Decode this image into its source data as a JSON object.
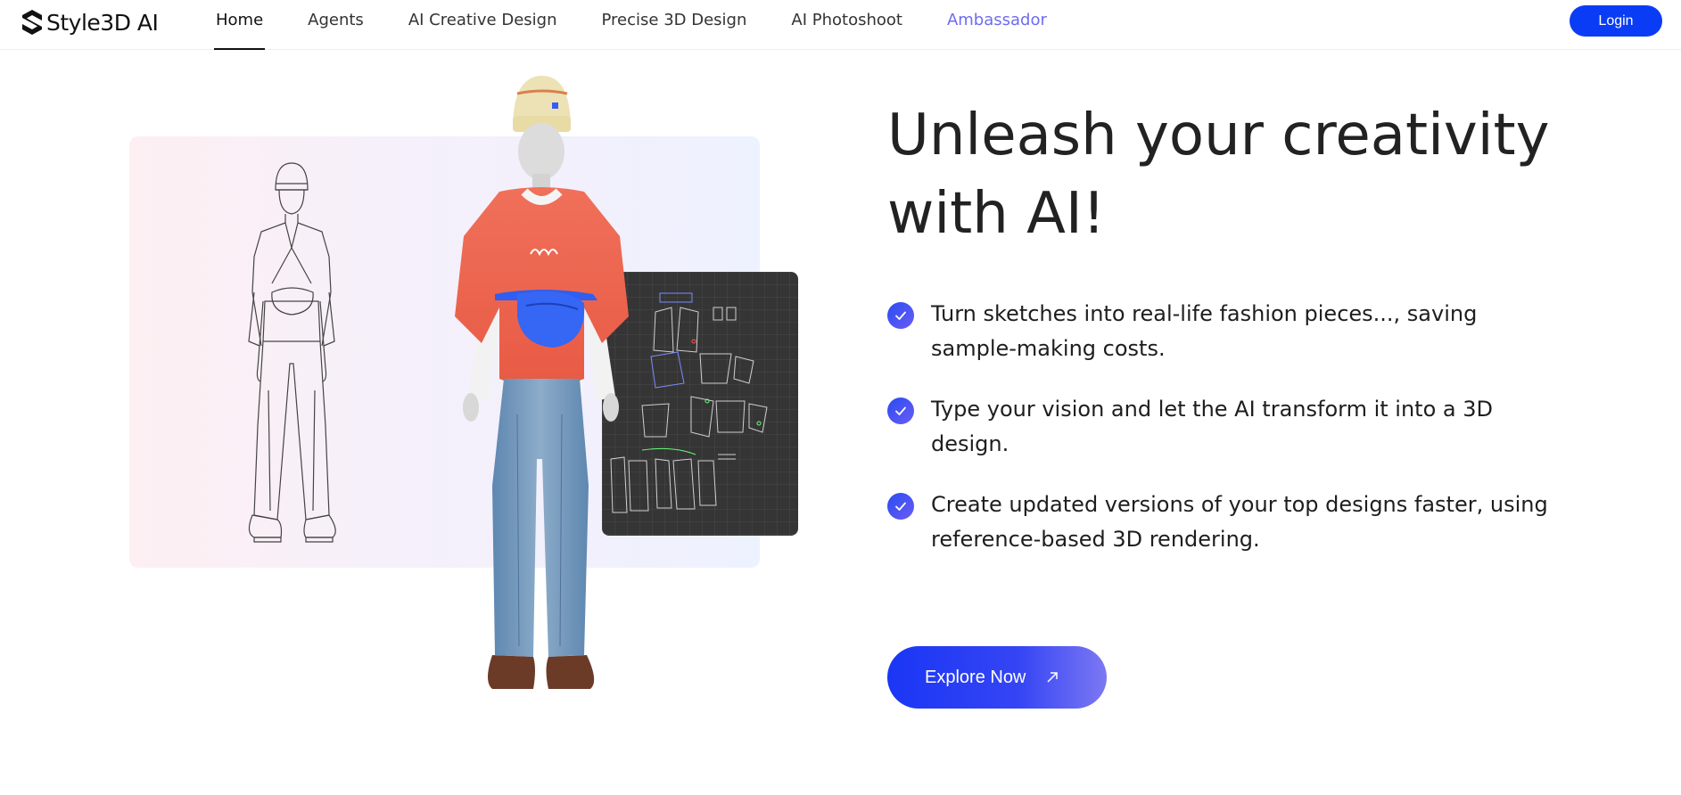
{
  "brand": {
    "name": "Style3D AI",
    "icon": "style3d-logo-icon"
  },
  "nav": {
    "items": [
      {
        "label": "Home",
        "active": true
      },
      {
        "label": "Agents"
      },
      {
        "label": "AI Creative Design"
      },
      {
        "label": "Precise 3D Design"
      },
      {
        "label": "AI Photoshoot"
      },
      {
        "label": "Ambassador",
        "highlight": true
      }
    ]
  },
  "header": {
    "login_label": "Login"
  },
  "hero": {
    "title": "Unleash your creativity with AI!",
    "features": [
      {
        "text": "Turn sketches into real-life fashion pieces..., saving sample-making costs.",
        "icon": "check-circle-icon"
      },
      {
        "text": "Type your vision and let the AI transform it into a 3D design.",
        "icon": "check-circle-icon"
      },
      {
        "text": "Create updated versions of your top designs faster, using reference-based 3D rendering.",
        "icon": "check-circle-icon"
      }
    ],
    "cta_label": "Explore Now",
    "cta_icon": "arrow-up-right-icon"
  },
  "colors": {
    "accent": "#0b3cf5",
    "highlight_nav": "#6f6cf0",
    "check_gradient_start": "#2a4cf2",
    "check_gradient_end": "#6a5cf5"
  }
}
